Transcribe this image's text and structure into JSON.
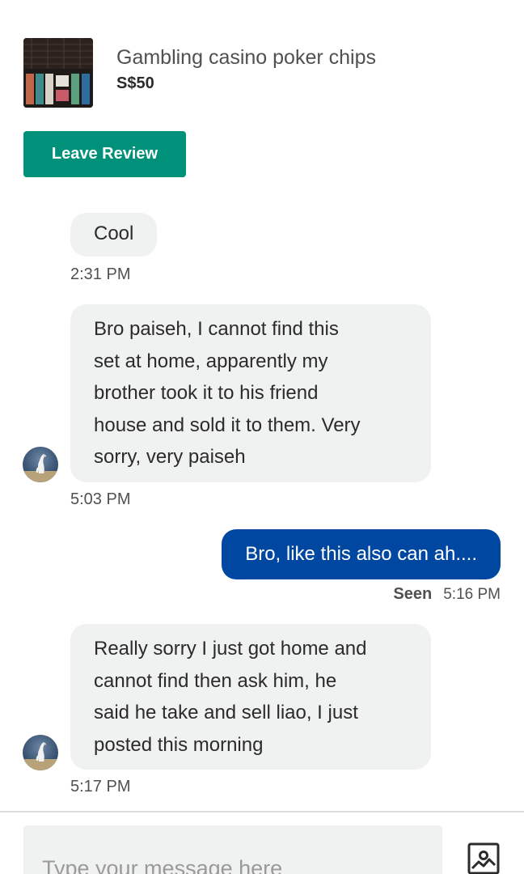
{
  "listing": {
    "title": "Gambling casino poker chips",
    "price": "S$50",
    "thumbnail_icon": "poker-chips-case-thumbnail"
  },
  "actions": {
    "leave_review_label": "Leave Review"
  },
  "messages": [
    {
      "direction": "incoming",
      "lines": [
        "Cool"
      ],
      "time": "2:31 PM",
      "show_avatar": false
    },
    {
      "direction": "incoming",
      "lines": [
        "Bro paiseh, I cannot find this",
        "set at home, apparently my",
        "brother took it to his friend",
        "house and sold it to them.  Very",
        "sorry, very paiseh"
      ],
      "time": "5:03 PM",
      "show_avatar": true
    },
    {
      "direction": "outgoing",
      "lines": [
        "Bro, like this also can ah...."
      ],
      "status": "Seen",
      "time": "5:16 PM"
    },
    {
      "direction": "incoming",
      "lines": [
        "Really sorry I just got home and",
        "cannot find then ask him, he",
        "said he take and sell liao, I just",
        "posted this morning"
      ],
      "time": "5:17 PM",
      "show_avatar": true
    }
  ],
  "composer": {
    "placeholder": "Type your message here",
    "photo_icon": "add-photo-icon"
  },
  "colors": {
    "review_button": "#00917a",
    "outgoing_bubble": "#0047a1",
    "incoming_bubble": "#f0f1f1"
  }
}
